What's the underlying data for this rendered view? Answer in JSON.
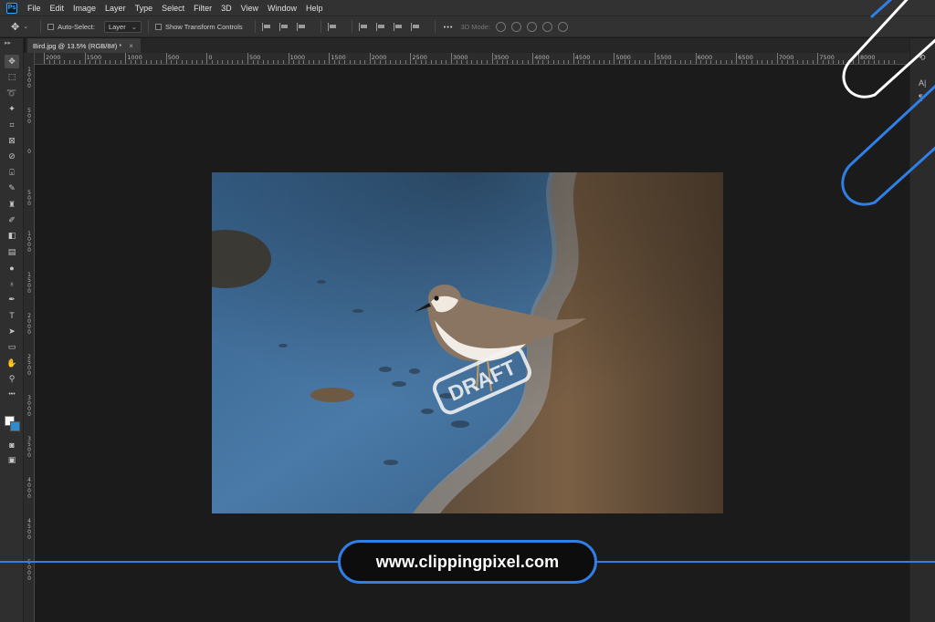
{
  "app": {
    "logo_text": "Ps"
  },
  "menu": [
    "File",
    "Edit",
    "Image",
    "Layer",
    "Type",
    "Select",
    "Filter",
    "3D",
    "View",
    "Window",
    "Help"
  ],
  "options": {
    "auto_select_label": "Auto-Select:",
    "auto_select_value": "Layer",
    "transform_label": "Show Transform Controls",
    "more_label": "•••",
    "mode_3d_label": "3D Mode:"
  },
  "document": {
    "tab_title": "Bird.jpg @ 13.5% (RGB/8#) *",
    "close_glyph": "×",
    "watermark_text": "DRAFT"
  },
  "ruler": {
    "top_labels": [
      "2000",
      "1500",
      "1000",
      "500",
      "0",
      "500",
      "1000",
      "1500",
      "2000",
      "2500",
      "3000",
      "3500",
      "4000",
      "4500",
      "5000",
      "5500",
      "6000",
      "6500",
      "7000",
      "7500",
      "8000"
    ],
    "left_labels": [
      "1000",
      "500",
      "0",
      "500",
      "1000",
      "1500",
      "2000",
      "2500",
      "3000",
      "3500",
      "4000",
      "4500",
      "5000"
    ]
  },
  "toolbar": {
    "tools": [
      {
        "icon": "move-icon",
        "glyph": "✥"
      },
      {
        "icon": "marquee-icon",
        "glyph": "⬚"
      },
      {
        "icon": "lasso-icon",
        "glyph": "➰"
      },
      {
        "icon": "magic-wand-icon",
        "glyph": "✦"
      },
      {
        "icon": "crop-icon",
        "glyph": "⌗"
      },
      {
        "icon": "frame-icon",
        "glyph": "⊠"
      },
      {
        "icon": "eyedropper-icon",
        "glyph": "⊘"
      },
      {
        "icon": "healing-brush-icon",
        "glyph": "⌺"
      },
      {
        "icon": "brush-icon",
        "glyph": "✎"
      },
      {
        "icon": "clone-stamp-icon",
        "glyph": "♜"
      },
      {
        "icon": "history-brush-icon",
        "glyph": "✐"
      },
      {
        "icon": "eraser-icon",
        "glyph": "◧"
      },
      {
        "icon": "gradient-icon",
        "glyph": "▤"
      },
      {
        "icon": "blur-icon",
        "glyph": "●"
      },
      {
        "icon": "dodge-icon",
        "glyph": "♁"
      },
      {
        "icon": "pen-icon",
        "glyph": "✒"
      },
      {
        "icon": "type-icon",
        "glyph": "T"
      },
      {
        "icon": "path-selection-icon",
        "glyph": "➤"
      },
      {
        "icon": "rectangle-icon",
        "glyph": "▭"
      },
      {
        "icon": "hand-icon",
        "glyph": "✋"
      },
      {
        "icon": "zoom-icon",
        "glyph": "⚲"
      },
      {
        "icon": "more-tools-icon",
        "glyph": "•••"
      }
    ],
    "foreground_color": "#ffffff",
    "background_color": "#2d8ccf"
  },
  "right_panel": {
    "icons": [
      "history-icon",
      "character-icon",
      "paragraph-icon"
    ],
    "glyphs": [
      "⟲",
      "A|",
      "¶"
    ]
  },
  "banner": {
    "url": "www.clippingpixel.com",
    "accent_color": "#2f7fe6"
  }
}
